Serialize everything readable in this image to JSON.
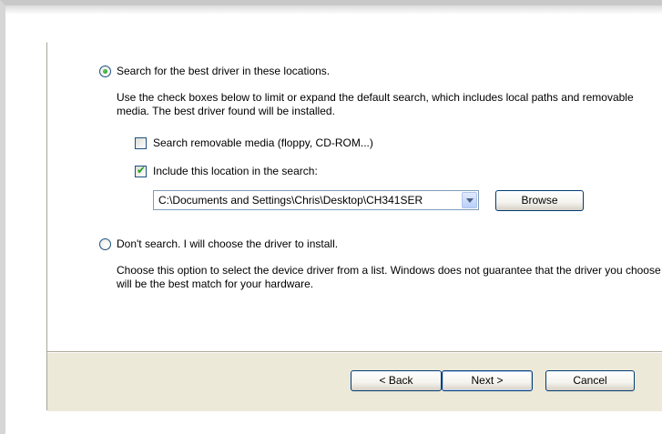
{
  "search_option": {
    "radio_label": "Search for the best driver in these locations.",
    "description": "Use the check boxes below to limit or expand the default search, which includes local paths and removable media. The best driver found will be installed.",
    "removable_media_label": "Search removable media (floppy, CD-ROM...)",
    "removable_media_checked": false,
    "include_location_label": "Include this location in the search:",
    "include_location_checked": true,
    "location_value": "C:\\Documents and Settings\\Chris\\Desktop\\CH341SER",
    "browse_label": "Browse"
  },
  "manual_option": {
    "radio_label": "Don't search. I will choose the driver to install.",
    "description": "Choose this option to select the device driver from a list.  Windows does not guarantee that the driver you choose will be the best match for your hardware."
  },
  "footer": {
    "back_label": "< Back",
    "next_label": "Next >",
    "cancel_label": "Cancel"
  },
  "icons": {
    "radio_selected": "radio-selected-icon",
    "radio_unselected": "radio-unselected-icon",
    "checkbox_checked": "checkmark-icon",
    "combo_arrow": "chevron-down-icon"
  },
  "colors": {
    "dialog_background": "#ece9d8",
    "body_background": "#ffffff",
    "control_border": "#1c5180",
    "check_green": "#21a121",
    "button_border": "#003c74"
  }
}
